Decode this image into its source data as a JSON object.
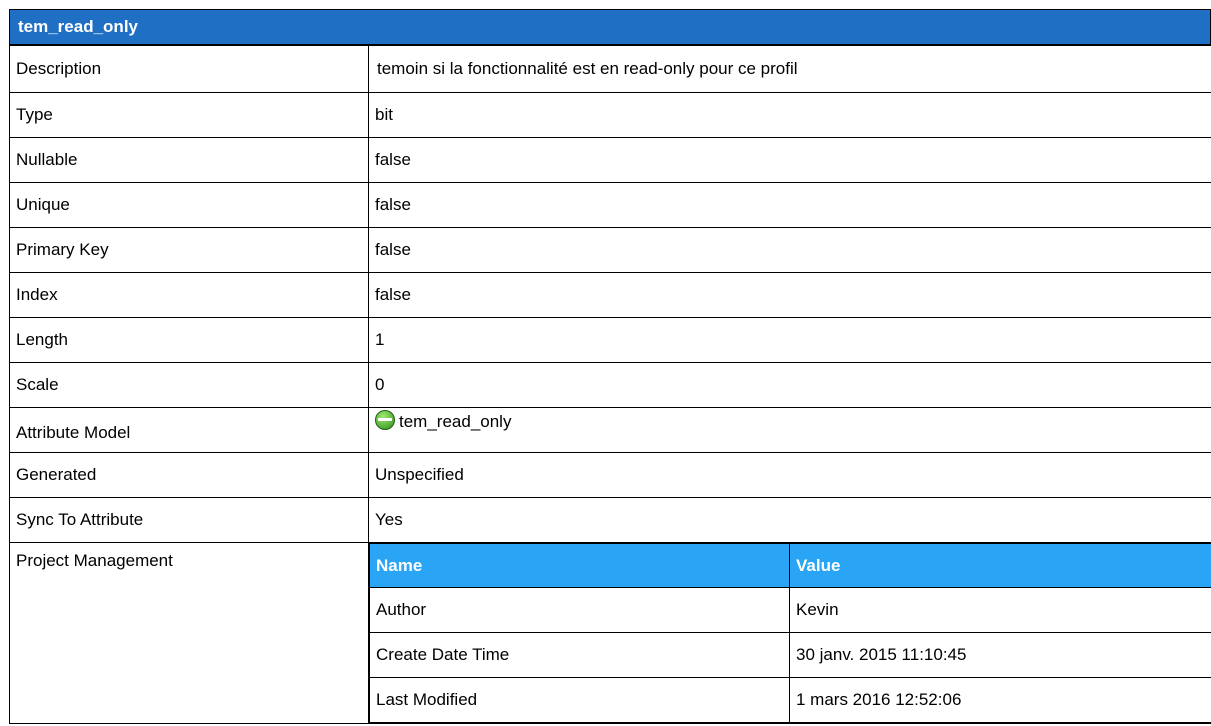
{
  "title": "tem_read_only",
  "rows": [
    {
      "label": "Description",
      "value": "temoin si la fonctionnalité est en read-only pour ce profil"
    },
    {
      "label": "Type",
      "value": "bit"
    },
    {
      "label": "Nullable",
      "value": "false"
    },
    {
      "label": "Unique",
      "value": "false"
    },
    {
      "label": "Primary Key",
      "value": "false"
    },
    {
      "label": "Index",
      "value": "false"
    },
    {
      "label": "Length",
      "value": "1"
    },
    {
      "label": "Scale",
      "value": "0"
    },
    {
      "label": "Attribute Model",
      "value": "tem_read_only",
      "icon": "attribute-icon"
    },
    {
      "label": "Generated",
      "value": "Unspecified"
    },
    {
      "label": "Sync To Attribute",
      "value": "Yes"
    }
  ],
  "project_management": {
    "label": "Project Management",
    "headers": [
      "Name",
      "Value"
    ],
    "rows": [
      [
        "Author",
        "Kevin"
      ],
      [
        "Create Date Time",
        "30 janv. 2015 11:10:45"
      ],
      [
        "Last Modified",
        "1 mars 2016 12:52:06"
      ]
    ]
  }
}
